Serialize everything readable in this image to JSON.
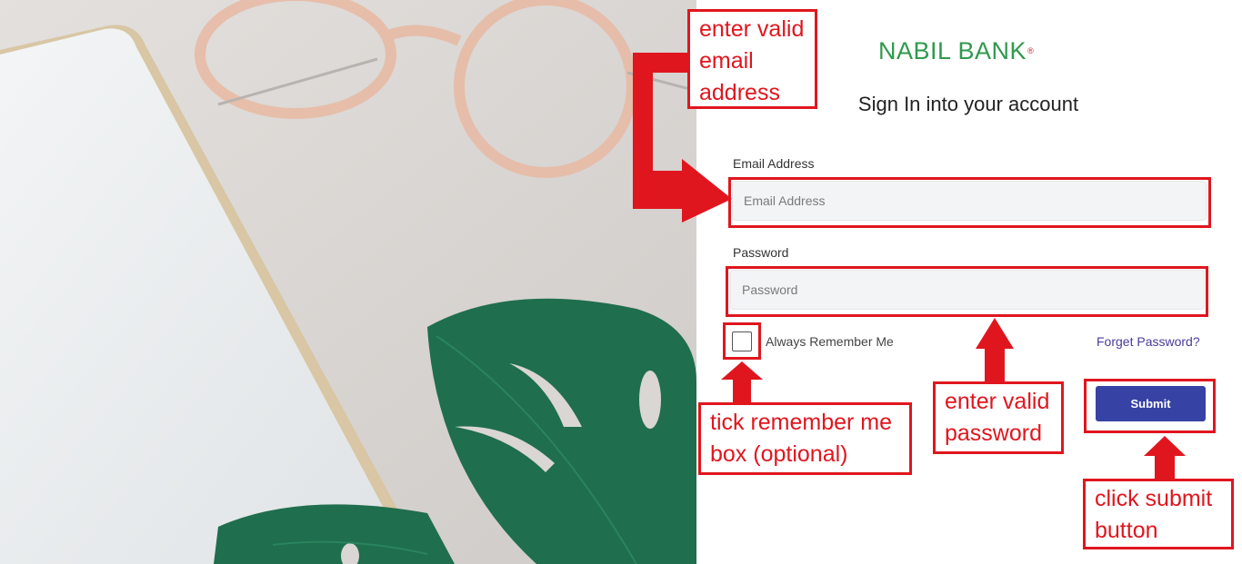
{
  "brand": {
    "logo_text": "NABIL BANK",
    "logo_mark": "®",
    "logo_color": "#2f9a4e"
  },
  "form": {
    "title": "Sign In into your account",
    "email_label": "Email Address",
    "email_placeholder": "Email Address",
    "password_label": "Password",
    "password_placeholder": "Password",
    "remember_label": "Always Remember Me",
    "forget_label": "Forget Password?",
    "submit_label": "Submit",
    "submit_color": "#3742a5"
  },
  "annotations": {
    "color": "#e0161e",
    "email": [
      "enter valid",
      "email",
      "address"
    ],
    "remember": [
      "tick remember me",
      "box (optional)"
    ],
    "password": [
      "enter valid",
      "password"
    ],
    "submit": [
      "click submit",
      "button"
    ]
  },
  "icons": {
    "checkbox": "checkbox-icon",
    "arrows": "arrow-icon"
  }
}
